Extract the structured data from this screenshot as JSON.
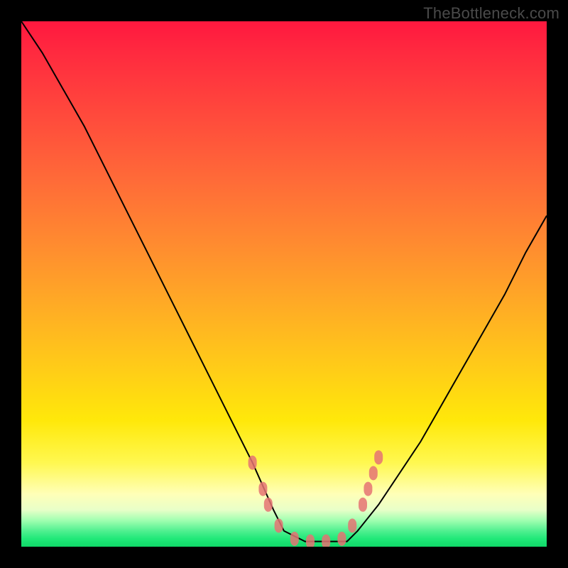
{
  "watermark": "TheBottleneck.com",
  "colors": {
    "gradient_top": "#ff183f",
    "gradient_mid": "#ffe80a",
    "gradient_bottom": "#10d868",
    "curve": "#000000",
    "marker": "#e57373",
    "frame": "#000000"
  },
  "chart_data": {
    "type": "line",
    "title": "",
    "xlabel": "",
    "ylabel": "",
    "xlim": [
      0,
      100
    ],
    "ylim": [
      0,
      100
    ],
    "grid": false,
    "legend": false,
    "note": "Axes are unlabelled in the source image; x/y are normalized 0–100. Curve is a V-shaped bottleneck profile: steep descent on the left, flat trough around x≈50–62, gentler rise on the right.",
    "series": [
      {
        "name": "bottleneck-curve",
        "x": [
          0,
          4,
          8,
          12,
          16,
          20,
          24,
          28,
          32,
          36,
          40,
          44,
          48,
          50,
          54,
          58,
          62,
          64,
          68,
          72,
          76,
          80,
          84,
          88,
          92,
          96,
          100
        ],
        "y": [
          100,
          94,
          87,
          80,
          72,
          64,
          56,
          48,
          40,
          32,
          24,
          16,
          7,
          3,
          1,
          1,
          1,
          3,
          8,
          14,
          20,
          27,
          34,
          41,
          48,
          56,
          63
        ]
      }
    ],
    "markers": {
      "name": "highlight-dots",
      "note": "Pink rounded markers near the trough on both sides and along the flat bottom.",
      "points": [
        {
          "x": 44,
          "y": 16
        },
        {
          "x": 46,
          "y": 11
        },
        {
          "x": 47,
          "y": 8
        },
        {
          "x": 49,
          "y": 4
        },
        {
          "x": 52,
          "y": 1.5
        },
        {
          "x": 55,
          "y": 1
        },
        {
          "x": 58,
          "y": 1
        },
        {
          "x": 61,
          "y": 1.5
        },
        {
          "x": 63,
          "y": 4
        },
        {
          "x": 65,
          "y": 8
        },
        {
          "x": 66,
          "y": 11
        },
        {
          "x": 67,
          "y": 14
        },
        {
          "x": 68,
          "y": 17
        }
      ]
    }
  }
}
